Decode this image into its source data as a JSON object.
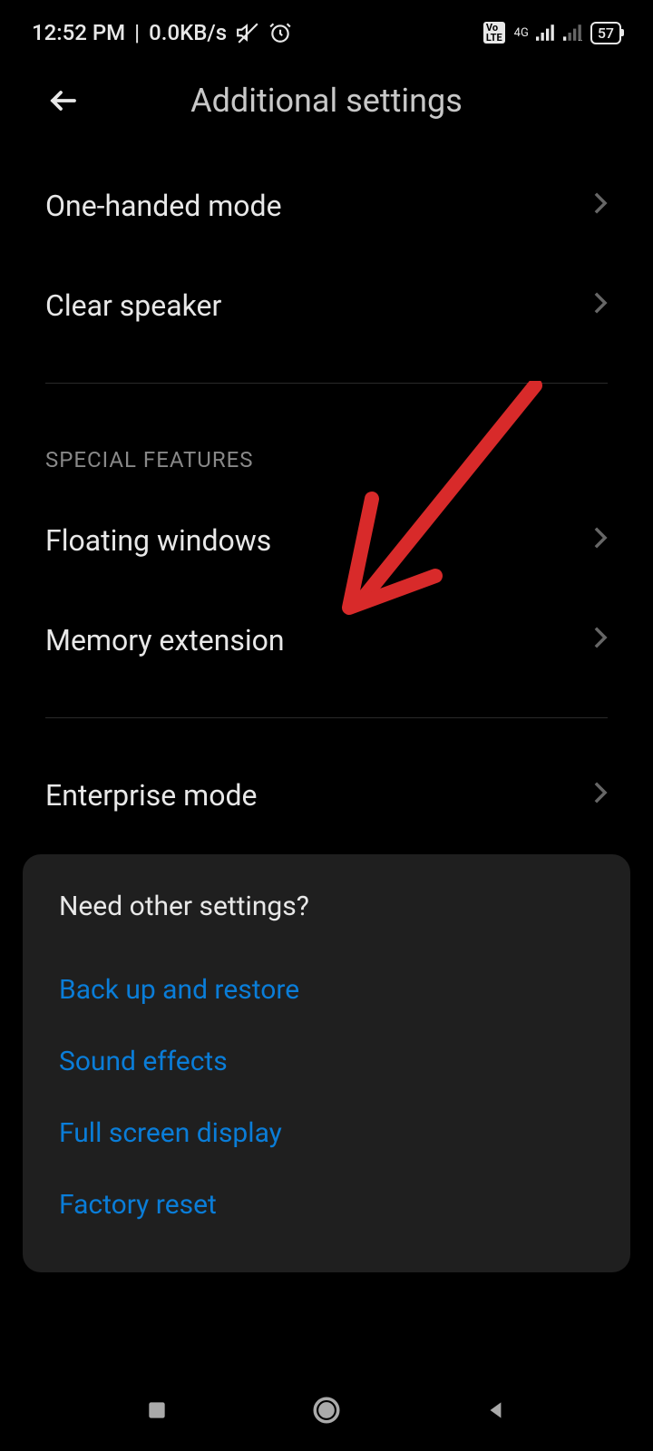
{
  "statusBar": {
    "time": "12:52 PM",
    "dataRate": "0.0KB/s",
    "networkType": "4G",
    "batteryPercent": "57"
  },
  "header": {
    "title": "Additional settings"
  },
  "topItems": [
    {
      "label": "One-handed mode"
    },
    {
      "label": "Clear speaker"
    }
  ],
  "specialSection": {
    "header": "SPECIAL FEATURES",
    "items": [
      {
        "label": "Floating windows"
      },
      {
        "label": "Memory extension"
      }
    ]
  },
  "bottomItems": [
    {
      "label": "Enterprise mode"
    }
  ],
  "relatedCard": {
    "title": "Need other settings?",
    "links": [
      {
        "label": "Back up and restore"
      },
      {
        "label": "Sound effects"
      },
      {
        "label": "Full screen display"
      },
      {
        "label": "Factory reset"
      }
    ]
  }
}
